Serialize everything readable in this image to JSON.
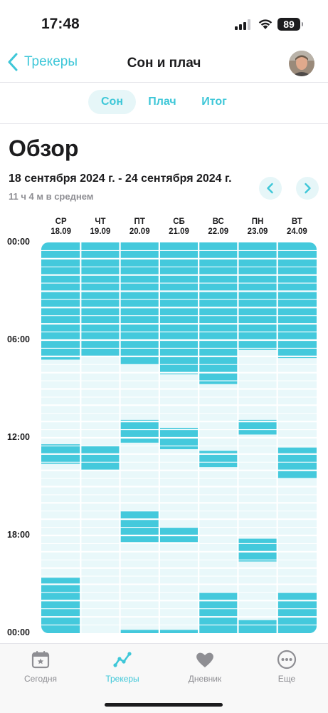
{
  "status_bar": {
    "time": "17:48",
    "battery": "89"
  },
  "nav": {
    "back_label": "Трекеры",
    "title": "Сон и плач"
  },
  "tabs": [
    {
      "label": "Сон",
      "active": true
    },
    {
      "label": "Плач",
      "active": false
    },
    {
      "label": "Итог",
      "active": false
    }
  ],
  "overview": {
    "title": "Обзор",
    "date_range": "18 сентября 2024 г. - 24 сентября 2024 г.",
    "average": "11 ч 4 м в среднем"
  },
  "chart_data": {
    "type": "heatmap",
    "y_labels": [
      "00:00",
      "06:00",
      "12:00",
      "18:00",
      "00:00"
    ],
    "y_range_hours": [
      0,
      24
    ],
    "color_sleep": "#44c9dc",
    "color_background": "#e9f8fa",
    "days": [
      {
        "weekday": "СР",
        "date": "18.09",
        "sleep": [
          [
            0,
            7.2
          ],
          [
            12.4,
            13.6
          ],
          [
            20.6,
            24
          ]
        ]
      },
      {
        "weekday": "ЧТ",
        "date": "19.09",
        "sleep": [
          [
            0,
            7.0
          ],
          [
            12.5,
            14.0
          ]
        ]
      },
      {
        "weekday": "ПТ",
        "date": "20.09",
        "sleep": [
          [
            0,
            7.5
          ],
          [
            10.9,
            12.3
          ],
          [
            16.5,
            18.4
          ],
          [
            23.8,
            24
          ]
        ]
      },
      {
        "weekday": "СБ",
        "date": "21.09",
        "sleep": [
          [
            0,
            8.1
          ],
          [
            11.4,
            12.7
          ],
          [
            17.5,
            18.4
          ],
          [
            23.8,
            24
          ]
        ]
      },
      {
        "weekday": "ВС",
        "date": "22.09",
        "sleep": [
          [
            0,
            8.7
          ],
          [
            12.8,
            13.8
          ],
          [
            21.5,
            24
          ]
        ]
      },
      {
        "weekday": "ПН",
        "date": "23.09",
        "sleep": [
          [
            0,
            6.6
          ],
          [
            10.9,
            11.8
          ],
          [
            18.2,
            19.6
          ],
          [
            23.2,
            24
          ]
        ]
      },
      {
        "weekday": "ВТ",
        "date": "24.09",
        "sleep": [
          [
            0,
            7.1
          ],
          [
            12.6,
            14.5
          ],
          [
            21.5,
            24
          ]
        ]
      }
    ]
  },
  "tab_bar": [
    {
      "label": "Сегодня",
      "icon": "calendar-star-icon",
      "active": false
    },
    {
      "label": "Трекеры",
      "icon": "trend-line-icon",
      "active": true
    },
    {
      "label": "Дневник",
      "icon": "heart-icon",
      "active": false
    },
    {
      "label": "Еще",
      "icon": "more-dots-icon",
      "active": false
    }
  ]
}
